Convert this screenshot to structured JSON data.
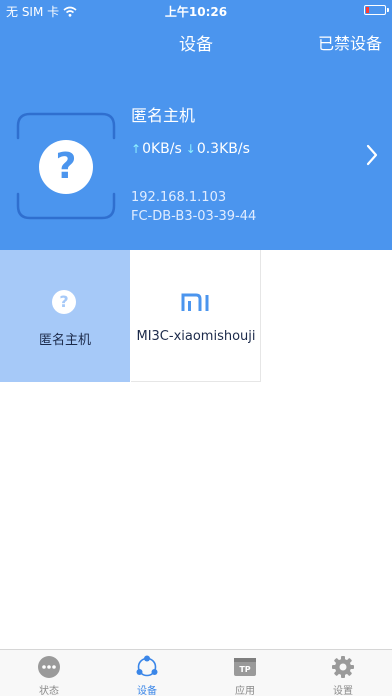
{
  "status_bar": {
    "carrier": "无 SIM 卡",
    "time": "上午10:26"
  },
  "nav": {
    "title": "设备",
    "right_button": "已禁设备"
  },
  "device_header": {
    "icon": "question-icon",
    "name": "匿名主机",
    "upload_speed": "0KB/s",
    "download_speed": "0.3KB/s",
    "ip": "192.168.1.103",
    "mac": "FC-DB-B3-03-39-44"
  },
  "devices": [
    {
      "name": "匿名主机",
      "icon": "question-icon",
      "selected": true
    },
    {
      "name": "MI3C-xiaomishouji",
      "icon": "mi-logo-icon",
      "selected": false
    }
  ],
  "tab_bar": {
    "items": [
      {
        "label": "状态",
        "icon": "status-dots-icon",
        "active": false
      },
      {
        "label": "设备",
        "icon": "devices-network-icon",
        "active": true
      },
      {
        "label": "应用",
        "icon": "apps-tp-icon",
        "active": false
      },
      {
        "label": "设置",
        "icon": "gear-icon",
        "active": false
      }
    ]
  },
  "colors": {
    "primary_blue": "#4b95ee",
    "selected_tile": "#a6c9f8",
    "active_tab": "#3a86e8",
    "inactive_tab": "#8a8a8a",
    "battery_low": "#ff3b30"
  }
}
